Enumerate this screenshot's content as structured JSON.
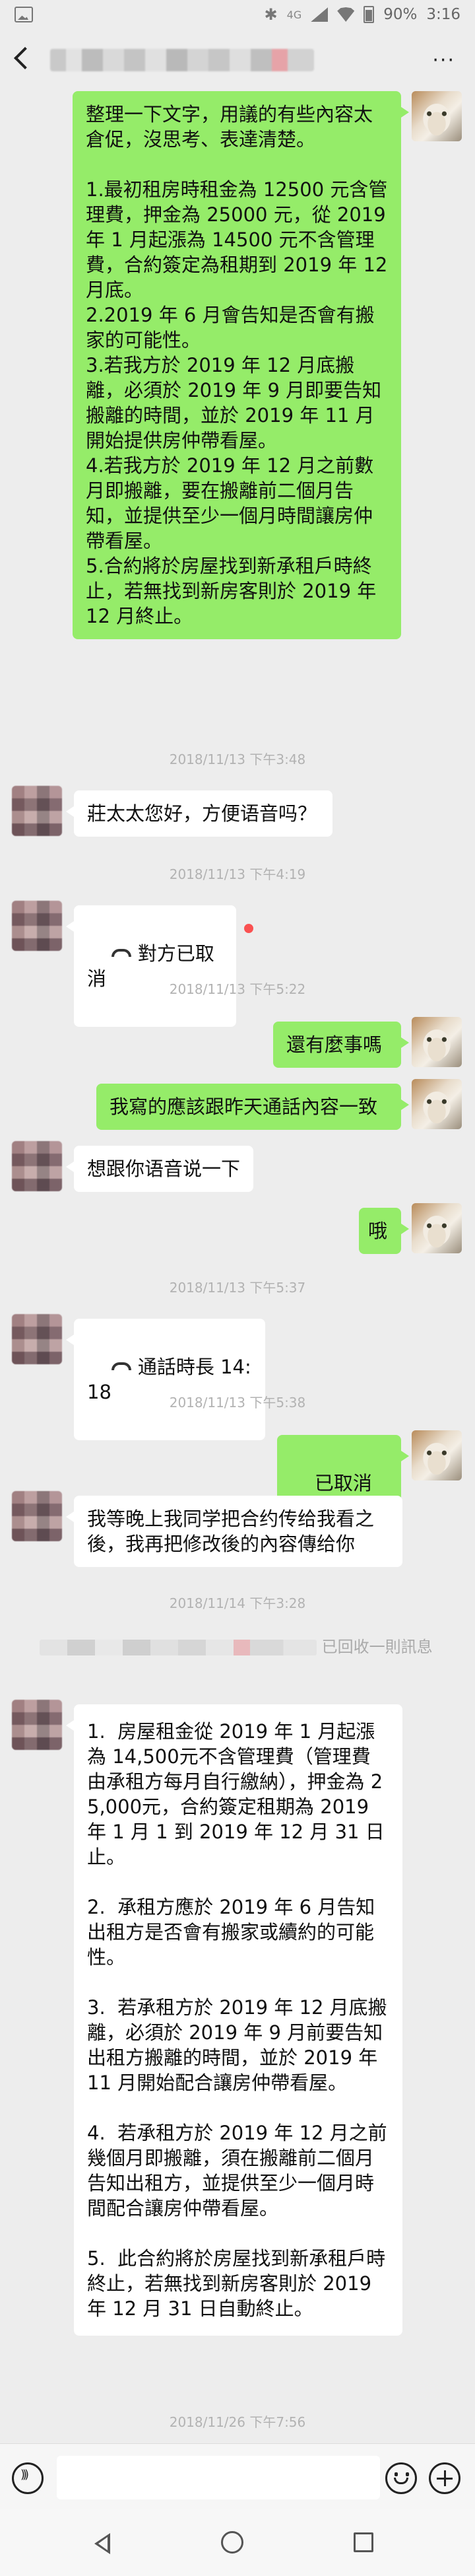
{
  "status_bar": {
    "network": "4G",
    "battery": "90%",
    "time": "3:16"
  },
  "header": {
    "title": "",
    "back_icon": "chevron-left-icon",
    "more_icon": "more-dots-icon"
  },
  "messages": {
    "m1": {
      "side": "right",
      "text": "整理一下文字，用議的有些內容太倉促，沒思考、表達清楚。\n\n1.最初租房時租金為 12500 元含管理費，押金為 25000 元，從 2019 年 1 月起漲為 14500 元不含管理費，合約簽定為租期到 2019 年 12 月底。\n2.2019 年 6 月會告知是否會有搬家的可能性。\n3.若我方於 2019 年 12 月底搬離，必須於 2019 年 9 月即要告知搬離的時間，並於 2019 年 11 月開始提供房仲帶看屋。\n4.若我方於 2019 年 12 月之前數月即搬離，要在搬離前二個月告知，並提供至少一個月時間讓房仲帶看屋。\n5.合約將於房屋找到新承租戶時終止，若無找到新房客則於 2019 年 12 月終止。"
    },
    "t1": "2018/11/13 下午3:48",
    "m2": {
      "side": "left",
      "text": "莊太太您好，方便语音吗？"
    },
    "t2": "2018/11/13 下午4:19",
    "m3": {
      "side": "left",
      "text": "對方已取消"
    },
    "t3": "2018/11/13 下午5:22",
    "m4": {
      "side": "right",
      "text": "還有麼事嗎"
    },
    "m5": {
      "side": "right",
      "text": "我寫的應該跟昨天通話內容一致"
    },
    "m6": {
      "side": "left",
      "text": "想跟你语音说一下"
    },
    "m7": {
      "side": "right",
      "text": "哦"
    },
    "t4": "2018/11/13 下午5:37",
    "m8": {
      "side": "left",
      "text": "通話時長 14:18"
    },
    "t5": "2018/11/13 下午5:38",
    "m9": {
      "side": "right",
      "text": "已取消"
    },
    "m10": {
      "side": "left",
      "text": "我等晚上我同学把合约传给我看之後，我再把修改後的內容傳给你"
    },
    "t6": "2018/11/14 下午3:28",
    "recall": "已回收一則訊息",
    "m11": {
      "side": "left",
      "text": "1.  房屋租金從 2019 年 1 月起漲為 14,500元不含管理費（管理費由承租方每月自行繳納），押金為 25,000元，合約簽定租期為 2019 年 1 月 1 到 2019 年 12 月 31 日止。\n\n2.  承租方應於 2019 年 6 月告知出租方是否會有搬家或續約的可能性。\n\n3.  若承租方於 2019 年 12 月底搬離，必須於 2019 年 9 月前要告知出租方搬離的時間，並於 2019 年 11 月開始配合讓房仲帶看屋。\n\n4.  若承租方於 2019 年 12 月之前幾個月即搬離，須在搬離前二個月告知出租方，並提供至少一個月時間配合讓房仲帶看屋。\n\n5.  此合約將於房屋找到新承租戶時終止，若無找到新房客則於 2019 年 12 月 31 日自動終止。"
    },
    "t7": "2018/11/26 下午7:56"
  },
  "input_bar": {
    "placeholder": "",
    "voice_icon": "voice-icon",
    "emoji_icon": "emoji-icon",
    "plus_icon": "plus-icon"
  },
  "colors": {
    "background": "#ededed",
    "bubble_self": "#95ec69",
    "bubble_other": "#ffffff",
    "timestamp": "#b2b2b2",
    "unread_dot": "#fa5151"
  }
}
